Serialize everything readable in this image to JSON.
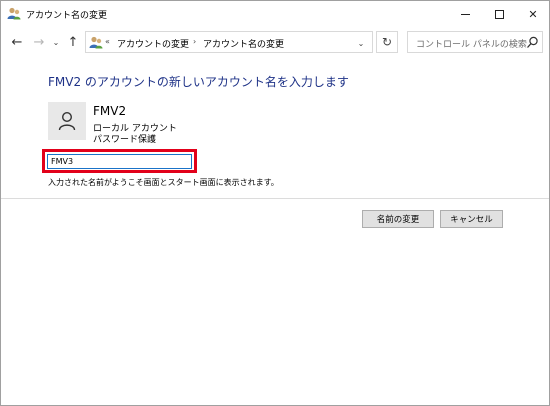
{
  "window": {
    "title": "アカウント名の変更",
    "controls": {
      "minimize": "minimize",
      "maximize": "maximize",
      "close": "✕"
    }
  },
  "nav": {
    "back": "←",
    "forward": "→",
    "recent": "⌄",
    "up": "↑",
    "breadcrumb_chevron": "«",
    "breadcrumbs": [
      "アカウントの変更",
      "アカウント名の変更"
    ],
    "separator": "›",
    "dropdown": "⌄",
    "refresh": "↻",
    "search_placeholder": "コントロール パネルの検索"
  },
  "main": {
    "heading": "FMV2 のアカウントの新しいアカウント名を入力します",
    "account": {
      "name": "FMV2",
      "type": "ローカル アカウント",
      "password": "パスワード保護"
    },
    "new_name_input": {
      "value": "FMV3"
    },
    "hint": "入力された名前がようこそ画面とスタート画面に表示されます。"
  },
  "buttons": {
    "rename": "名前の変更",
    "cancel": "キャンセル"
  },
  "colors": {
    "heading": "#1e3287",
    "highlight": "#e2001a",
    "input_border": "#1a73c8"
  },
  "icons": {
    "app": "user-accounts-icon",
    "avatar": "user-silhouette-icon",
    "search": "search-icon"
  }
}
